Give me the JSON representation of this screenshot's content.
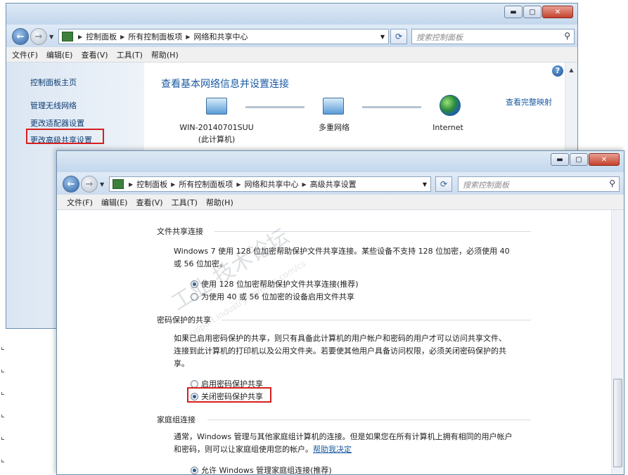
{
  "window1": {
    "breadcrumb": [
      "控制面板",
      "所有控制面板项",
      "网络和共享中心"
    ],
    "search_placeholder": "搜索控制面板",
    "menu": [
      "文件(F)",
      "编辑(E)",
      "查看(V)",
      "工具(T)",
      "帮助(H)"
    ],
    "sidebar": [
      "控制面板主页",
      "管理无线网络",
      "更改适配器设置",
      "更改高级共享设置"
    ],
    "title": "查看基本网络信息并设置连接",
    "full_map_link": "查看完整映射",
    "nodes": [
      {
        "label": "WIN-20140701SUU",
        "sub": "(此计算机)"
      },
      {
        "label": "多重网络",
        "sub": ""
      },
      {
        "label": "Internet",
        "sub": ""
      }
    ]
  },
  "window2": {
    "breadcrumb": [
      "控制面板",
      "所有控制面板项",
      "网络和共享中心",
      "高级共享设置"
    ],
    "search_placeholder": "搜索控制面板",
    "menu": [
      "文件(F)",
      "编辑(E)",
      "查看(V)",
      "工具(T)",
      "帮助(H)"
    ],
    "sections": [
      {
        "title": "文件共享连接",
        "desc": [
          "Windows 7 使用 128 位加密帮助保护文件共享连接。某些设备不支持 128 位加密，必须使用 40",
          "或 56 位加密。"
        ],
        "options": [
          "使用 128 位加密帮助保护文件共享连接(推荐)",
          "为使用 40 或 56 位加密的设备启用文件共享"
        ],
        "selected": 0
      },
      {
        "title": "密码保护的共享",
        "desc": [
          "如果已启用密码保护的共享，则只有具备此计算机的用户帐户和密码的用户才可以访问共享文件、",
          "连接到此计算机的打印机以及公用文件夹。若要使其他用户具备访问权限，必须关闭密码保护的共",
          "享。"
        ],
        "options": [
          "启用密码保护共享",
          "关闭密码保护共享"
        ],
        "selected": 1
      },
      {
        "title": "家庭组连接",
        "desc": [
          "通常，Windows 管理与其他家庭组计算机的连接。但是如果您在所有计算机上拥有相同的用户帐户",
          "和密码，则可以让家庭组使用您的帐户。"
        ],
        "help_link": "帮助我决定",
        "options": [
          "允许 Windows 管理家庭组连接(推荐)"
        ],
        "selected": 0
      }
    ]
  },
  "watermark": {
    "text": "工业 技术论坛",
    "url": "support.industry.siemens.com/cs"
  }
}
